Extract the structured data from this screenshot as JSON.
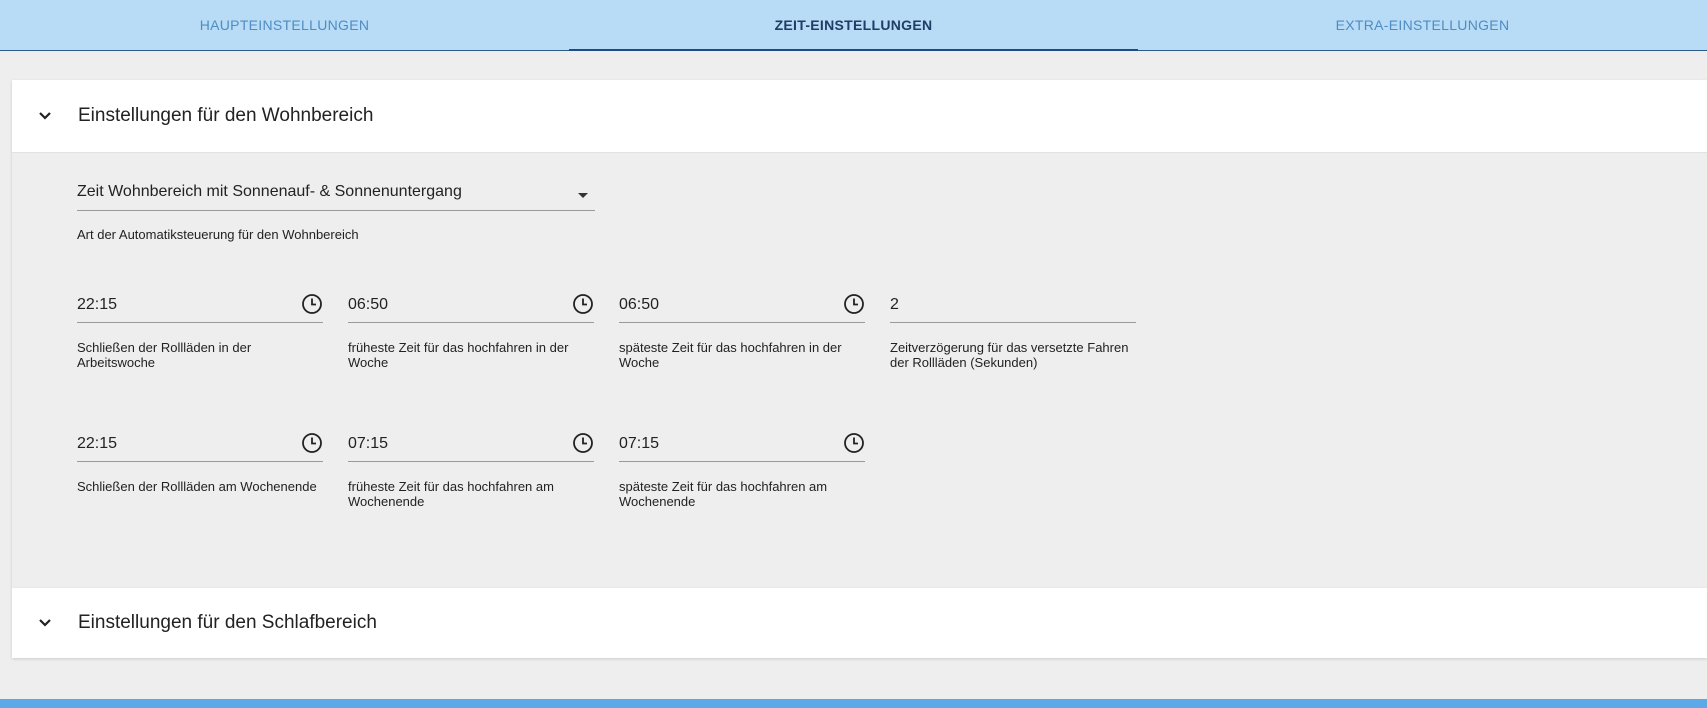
{
  "tabs": [
    {
      "label": "HAUPTEINSTELLUNGEN",
      "active": false
    },
    {
      "label": "ZEIT-EINSTELLUNGEN",
      "active": true
    },
    {
      "label": "EXTRA-EINSTELLUNGEN",
      "active": false
    }
  ],
  "living": {
    "title": "Einstellungen für den Wohnbereich",
    "select": {
      "value": "Zeit Wohnbereich mit Sonnenauf- & Sonnenuntergang",
      "helper": "Art der Automatiksteuerung für den Wohnbereich"
    },
    "week_close": {
      "value": "22:15",
      "label": "Schließen der Rollläden in der Arbeitswoche"
    },
    "week_earliest": {
      "value": "06:50",
      "label": "früheste Zeit für das hochfahren in der Woche"
    },
    "week_latest": {
      "value": "06:50",
      "label": "späteste Zeit für das hochfahren in der Woche"
    },
    "delay": {
      "value": "2",
      "label": "Zeitverzögerung für das versetzte Fahren der Rollläden (Sekunden)"
    },
    "weekend_close": {
      "value": "22:15",
      "label": "Schließen der Rollläden am Wochenende"
    },
    "weekend_earliest": {
      "value": "07:15",
      "label": "früheste Zeit für das hochfahren am Wochenende"
    },
    "weekend_latest": {
      "value": "07:15",
      "label": "späteste Zeit für das hochfahren am Wochenende"
    }
  },
  "sleeping": {
    "title": "Einstellungen für den Schlafbereich"
  },
  "colors": {
    "tab_bar": "#b8dcf6",
    "tab_active_text": "#1f3d66",
    "tab_inactive_text": "#4f8cc3",
    "footer_bar": "#5da8e6"
  }
}
